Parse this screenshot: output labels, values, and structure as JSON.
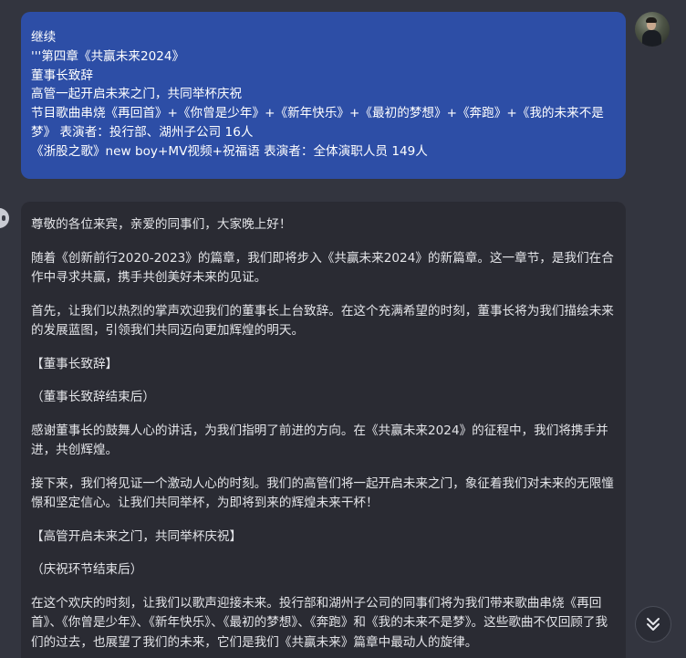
{
  "user_message": {
    "lines": [
      "继续",
      "'''第四章《共赢未来2024》",
      "董事长致辞",
      "高管一起开启未来之门，共同举杯庆祝",
      "节目歌曲串烧《再回首》+《你曾是少年》+《新年快乐》+《最初的梦想》+《奔跑》+《我的未来不是梦》  表演者：投行部、湖州子公司  16人",
      "《浙股之歌》new boy+MV视频+祝福语        表演者：全体演职人员     149人"
    ]
  },
  "assistant_message": {
    "paragraphs": [
      "尊敬的各位来宾，亲爱的同事们，大家晚上好！",
      "随着《创新前行2020-2023》的篇章，我们即将步入《共赢未来2024》的新篇章。这一章节，是我们在合作中寻求共赢，携手共创美好未来的见证。",
      "首先，让我们以热烈的掌声欢迎我们的董事长上台致辞。在这个充满希望的时刻，董事长将为我们描绘未来的发展蓝图，引领我们共同迈向更加辉煌的明天。",
      "【董事长致辞】",
      "（董事长致辞结束后）",
      "感谢董事长的鼓舞人心的讲话，为我们指明了前进的方向。在《共赢未来2024》的征程中，我们将携手并进，共创辉煌。",
      "接下来，我们将见证一个激动人心的时刻。我们的高管们将一起开启未来之门，象征着我们对未来的无限憧憬和坚定信心。让我们共同举杯，为即将到来的辉煌未来干杯！",
      "【高管开启未来之门，共同举杯庆祝】",
      "（庆祝环节结束后）",
      "在这个欢庆的时刻，让我们以歌声迎接未来。投行部和湖州子公司的同事们将为我们带来歌曲串烧《再回首》、《你曾是少年》、《新年快乐》、《最初的梦想》、《奔跑》和《我的未来不是梦》。这些歌曲不仅回顾了我们的过去，也展望了我们的未来，它们是我们《共赢未来》篇章中最动人的旋律。"
    ]
  },
  "icons": {
    "user_avatar": "user-avatar",
    "assistant_avatar": "bot-avatar-icon",
    "scroll_down": "double-chevron-down-icon"
  },
  "colors": {
    "background": "#33353f",
    "user_bubble": "#2d4ea6",
    "assistant_bubble": "#2a2b33"
  }
}
